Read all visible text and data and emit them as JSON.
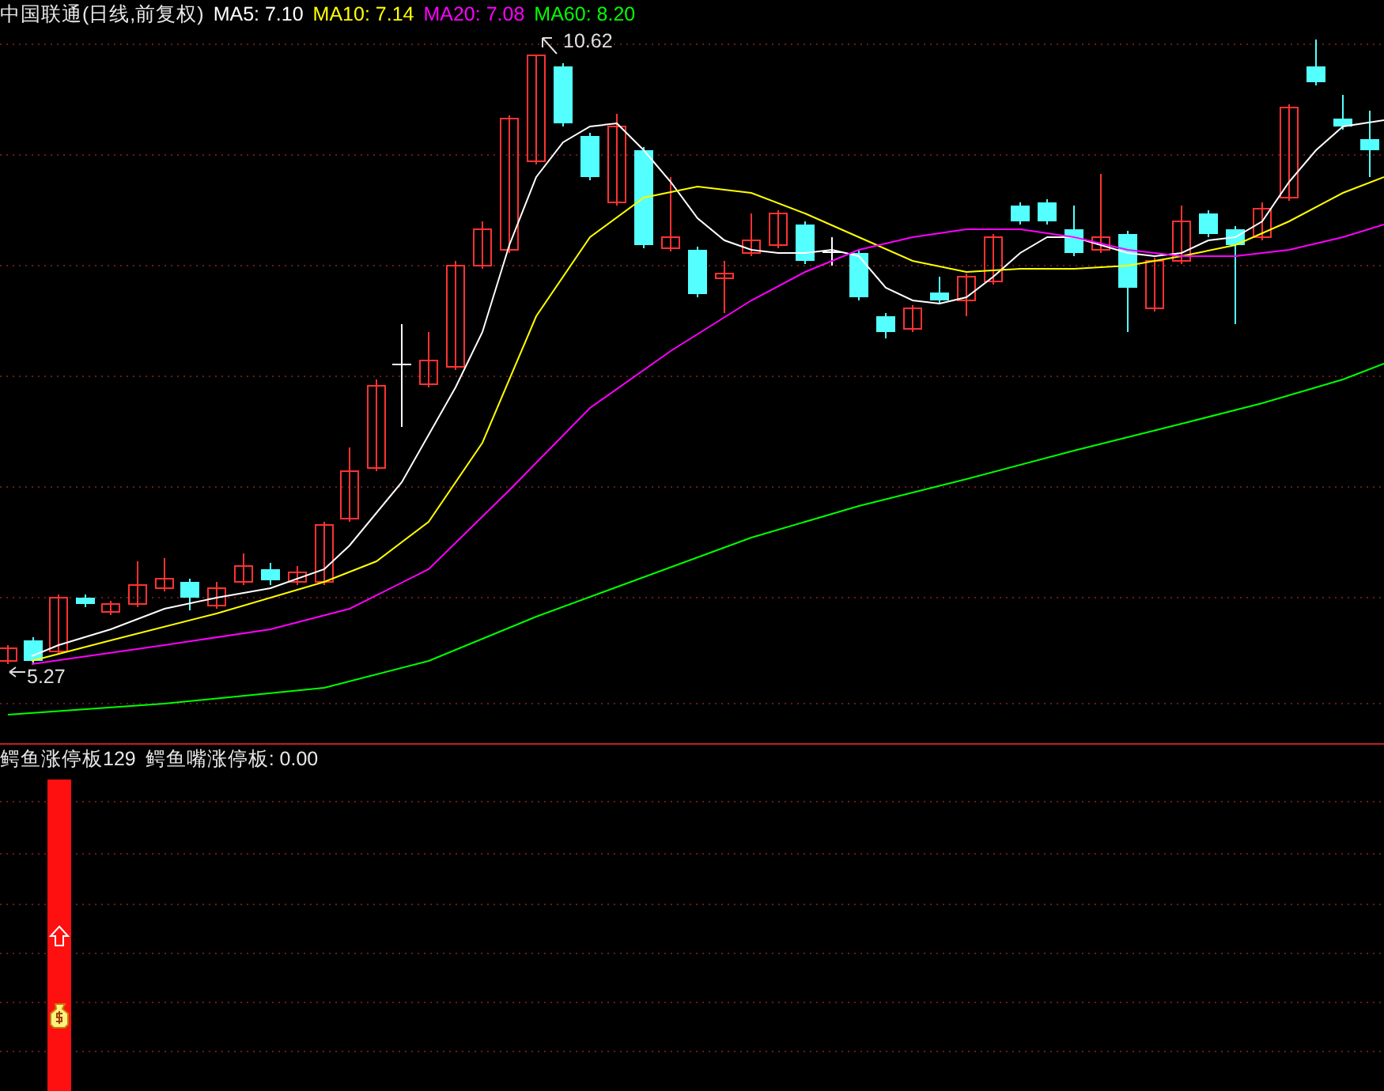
{
  "main_panel": {
    "title": "中国联通(日线,前复权)",
    "indicators": [
      {
        "label": "MA5: 7.10",
        "color": "#ffffff"
      },
      {
        "label": "MA10: 7.14",
        "color": "#ffff00"
      },
      {
        "label": "MA20: 7.08",
        "color": "#ff00ff"
      },
      {
        "label": "MA60: 8.20",
        "color": "#00ff00"
      }
    ],
    "high_label": "10.62",
    "low_label": "5.27"
  },
  "sub_panel": {
    "title": "鳄鱼涨停板129",
    "indicator": "鳄鱼嘴涨停板: 0.00"
  }
}
